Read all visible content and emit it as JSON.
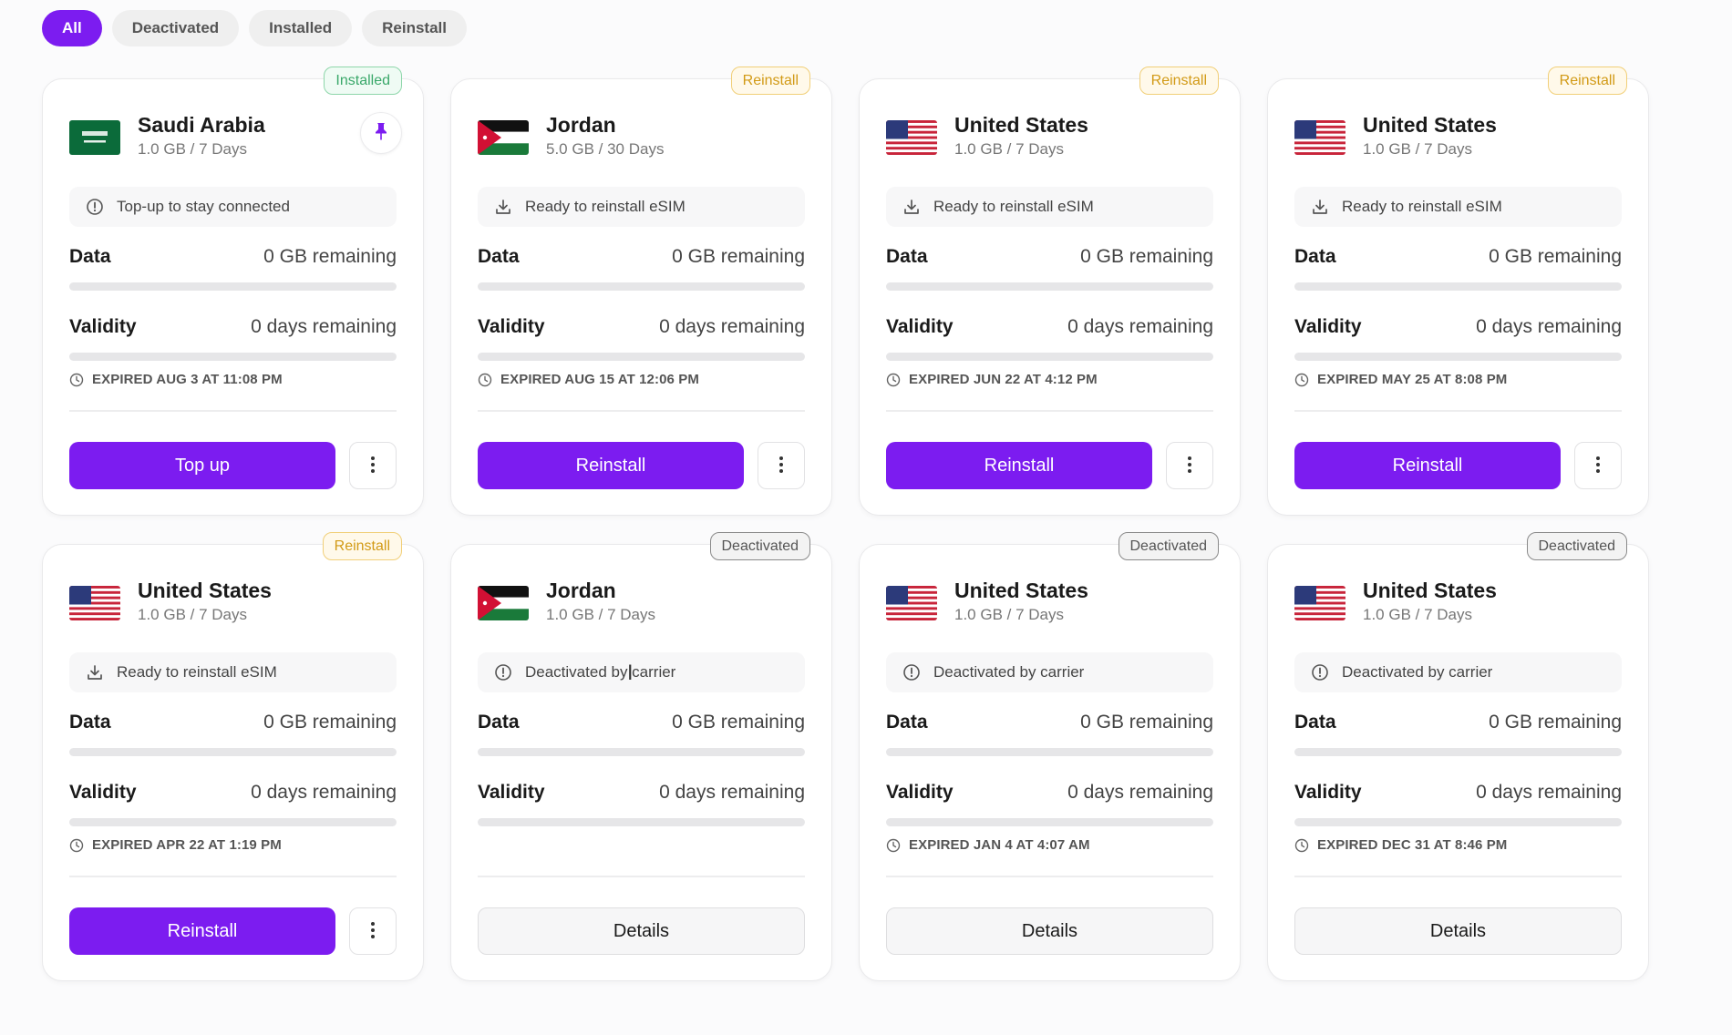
{
  "filters": [
    {
      "label": "All",
      "active": true
    },
    {
      "label": "Deactivated",
      "active": false
    },
    {
      "label": "Installed",
      "active": false
    },
    {
      "label": "Reinstall",
      "active": false
    }
  ],
  "labels": {
    "data": "Data",
    "validity": "Validity"
  },
  "colors": {
    "accent": "#7c1cf0"
  },
  "cards": [
    {
      "badge": "Installed",
      "badge_type": "installed",
      "flag": "sa",
      "country": "Saudi Arabia",
      "plan": "1.0 GB / 7 Days",
      "pinned": true,
      "status_icon": "alert-circle-icon",
      "status": "Top-up to stay connected",
      "data_value": "0 GB remaining",
      "validity_value": "0 days remaining",
      "expired": "EXPIRED AUG 3 AT 11:08 PM",
      "action": "Top up",
      "action_type": "primary"
    },
    {
      "badge": "Reinstall",
      "badge_type": "reinstall",
      "flag": "jo",
      "country": "Jordan",
      "plan": "5.0 GB / 30 Days",
      "pinned": false,
      "status_icon": "download-icon",
      "status": "Ready to reinstall eSIM",
      "data_value": "0 GB remaining",
      "validity_value": "0 days remaining",
      "expired": "EXPIRED AUG 15 AT 12:06 PM",
      "action": "Reinstall",
      "action_type": "primary"
    },
    {
      "badge": "Reinstall",
      "badge_type": "reinstall",
      "flag": "us",
      "country": "United States",
      "plan": "1.0 GB / 7 Days",
      "pinned": false,
      "status_icon": "download-icon",
      "status": "Ready to reinstall eSIM",
      "data_value": "0 GB remaining",
      "validity_value": "0 days remaining",
      "expired": "EXPIRED JUN 22 AT 4:12 PM",
      "action": "Reinstall",
      "action_type": "primary"
    },
    {
      "badge": "Reinstall",
      "badge_type": "reinstall",
      "flag": "us",
      "country": "United States",
      "plan": "1.0 GB / 7 Days",
      "pinned": false,
      "status_icon": "download-icon",
      "status": "Ready to reinstall eSIM",
      "data_value": "0 GB remaining",
      "validity_value": "0 days remaining",
      "expired": "EXPIRED MAY 25 AT 8:08 PM",
      "action": "Reinstall",
      "action_type": "primary"
    },
    {
      "badge": "Reinstall",
      "badge_type": "reinstall",
      "flag": "us",
      "country": "United States",
      "plan": "1.0 GB / 7 Days",
      "pinned": false,
      "status_icon": "download-icon",
      "status": "Ready to reinstall eSIM",
      "data_value": "0 GB remaining",
      "validity_value": "0 days remaining",
      "expired": "EXPIRED APR 22 AT 1:19 PM",
      "action": "Reinstall",
      "action_type": "primary"
    },
    {
      "badge": "Deactivated",
      "badge_type": "deactivated",
      "flag": "jo",
      "country": "Jordan",
      "plan": "1.0 GB / 7 Days",
      "pinned": false,
      "status_icon": "alert-circle-icon",
      "status": "Deactivated by carrier",
      "data_value": "0 GB remaining",
      "validity_value": "0 days remaining",
      "expired": "",
      "action": "Details",
      "action_type": "details"
    },
    {
      "badge": "Deactivated",
      "badge_type": "deactivated",
      "flag": "us",
      "country": "United States",
      "plan": "1.0 GB / 7 Days",
      "pinned": false,
      "status_icon": "alert-circle-icon",
      "status": "Deactivated by carrier",
      "data_value": "0 GB remaining",
      "validity_value": "0 days remaining",
      "expired": "EXPIRED JAN 4 AT 4:07 AM",
      "action": "Details",
      "action_type": "details"
    },
    {
      "badge": "Deactivated",
      "badge_type": "deactivated",
      "flag": "us",
      "country": "United States",
      "plan": "1.0 GB / 7 Days",
      "pinned": false,
      "status_icon": "alert-circle-icon",
      "status": "Deactivated by carrier",
      "data_value": "0 GB remaining",
      "validity_value": "0 days remaining",
      "expired": "EXPIRED DEC 31 AT 8:46 PM",
      "action": "Details",
      "action_type": "details"
    }
  ]
}
